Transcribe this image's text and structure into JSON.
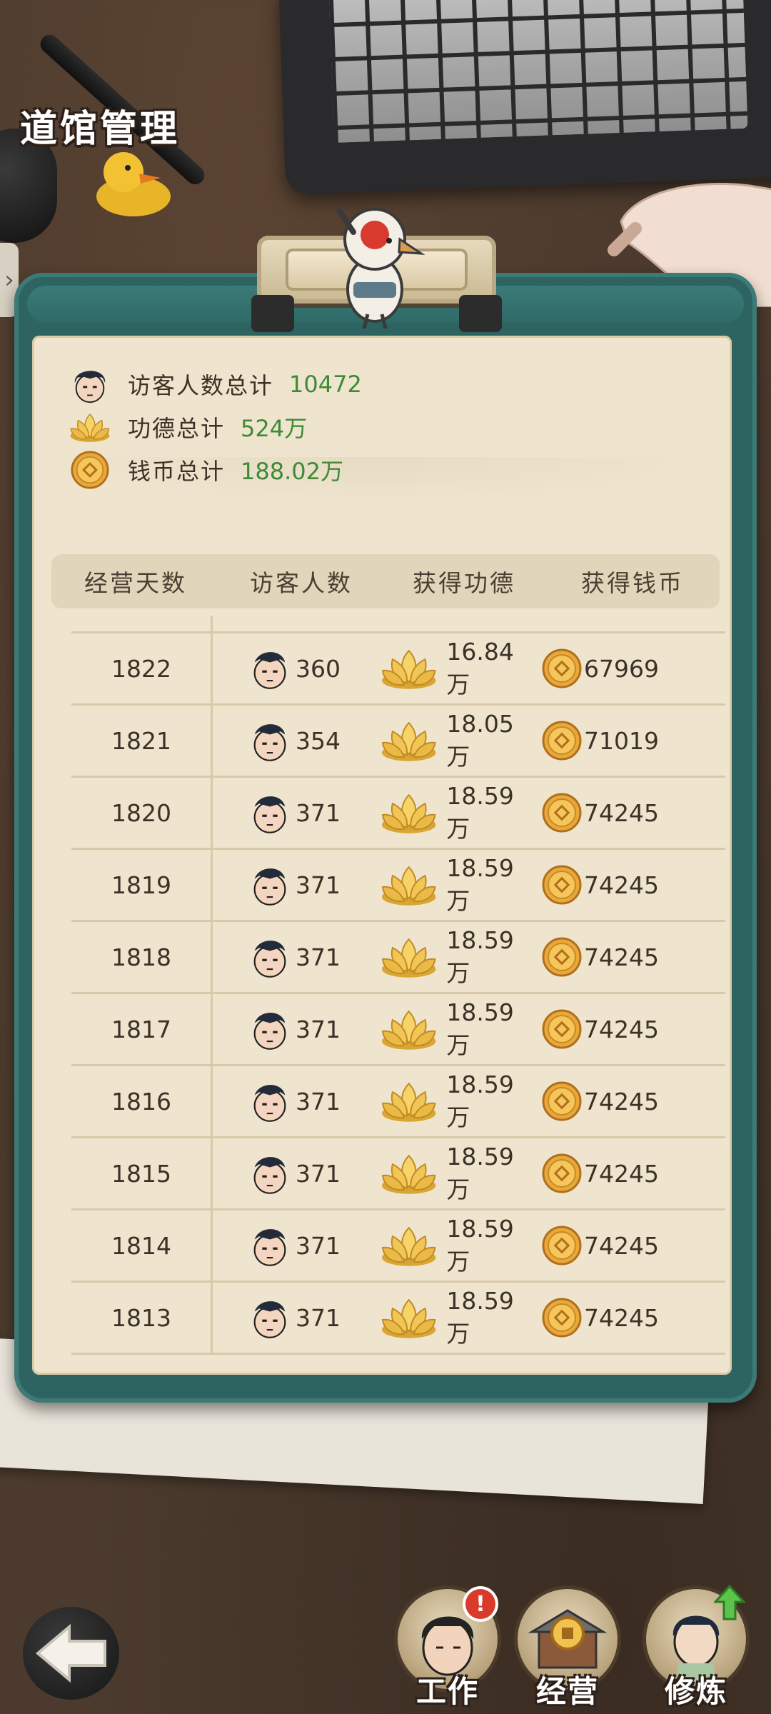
{
  "header": {
    "title": "道馆管理"
  },
  "summary": [
    {
      "icon": "visitor-face-icon",
      "label": "访客人数总计",
      "value": "10472"
    },
    {
      "icon": "lotus-merit-icon",
      "label": "功德总计",
      "value": "524万"
    },
    {
      "icon": "copper-coin-icon",
      "label": "钱币总计",
      "value": "188.02万"
    }
  ],
  "table": {
    "headers": [
      "经营天数",
      "访客人数",
      "获得功德",
      "获得钱币"
    ],
    "rows": [
      {
        "day": "1822",
        "visitors": "360",
        "merit": "16.84万",
        "coins": "67969"
      },
      {
        "day": "1821",
        "visitors": "354",
        "merit": "18.05万",
        "coins": "71019"
      },
      {
        "day": "1820",
        "visitors": "371",
        "merit": "18.59万",
        "coins": "74245"
      },
      {
        "day": "1819",
        "visitors": "371",
        "merit": "18.59万",
        "coins": "74245"
      },
      {
        "day": "1818",
        "visitors": "371",
        "merit": "18.59万",
        "coins": "74245"
      },
      {
        "day": "1817",
        "visitors": "371",
        "merit": "18.59万",
        "coins": "74245"
      },
      {
        "day": "1816",
        "visitors": "371",
        "merit": "18.59万",
        "coins": "74245"
      },
      {
        "day": "1815",
        "visitors": "371",
        "merit": "18.59万",
        "coins": "74245"
      },
      {
        "day": "1814",
        "visitors": "371",
        "merit": "18.59万",
        "coins": "74245"
      },
      {
        "day": "1813",
        "visitors": "371",
        "merit": "18.59万",
        "coins": "74245"
      }
    ]
  },
  "bottom_nav": {
    "back_icon": "back-arrow-icon",
    "items": [
      {
        "label": "工作",
        "badge": "!",
        "icon": "worker-portrait-icon"
      },
      {
        "label": "经营",
        "icon": "temple-coin-icon"
      },
      {
        "label": "修炼",
        "icon": "cultivator-portrait-icon",
        "indicator": "green-up-arrow"
      }
    ]
  },
  "colors": {
    "board": "#2d6462",
    "paper": "#efe5cf",
    "value_green": "#3f8a35",
    "text_brown": "#3c3126",
    "badge_red": "#d93a2b"
  }
}
